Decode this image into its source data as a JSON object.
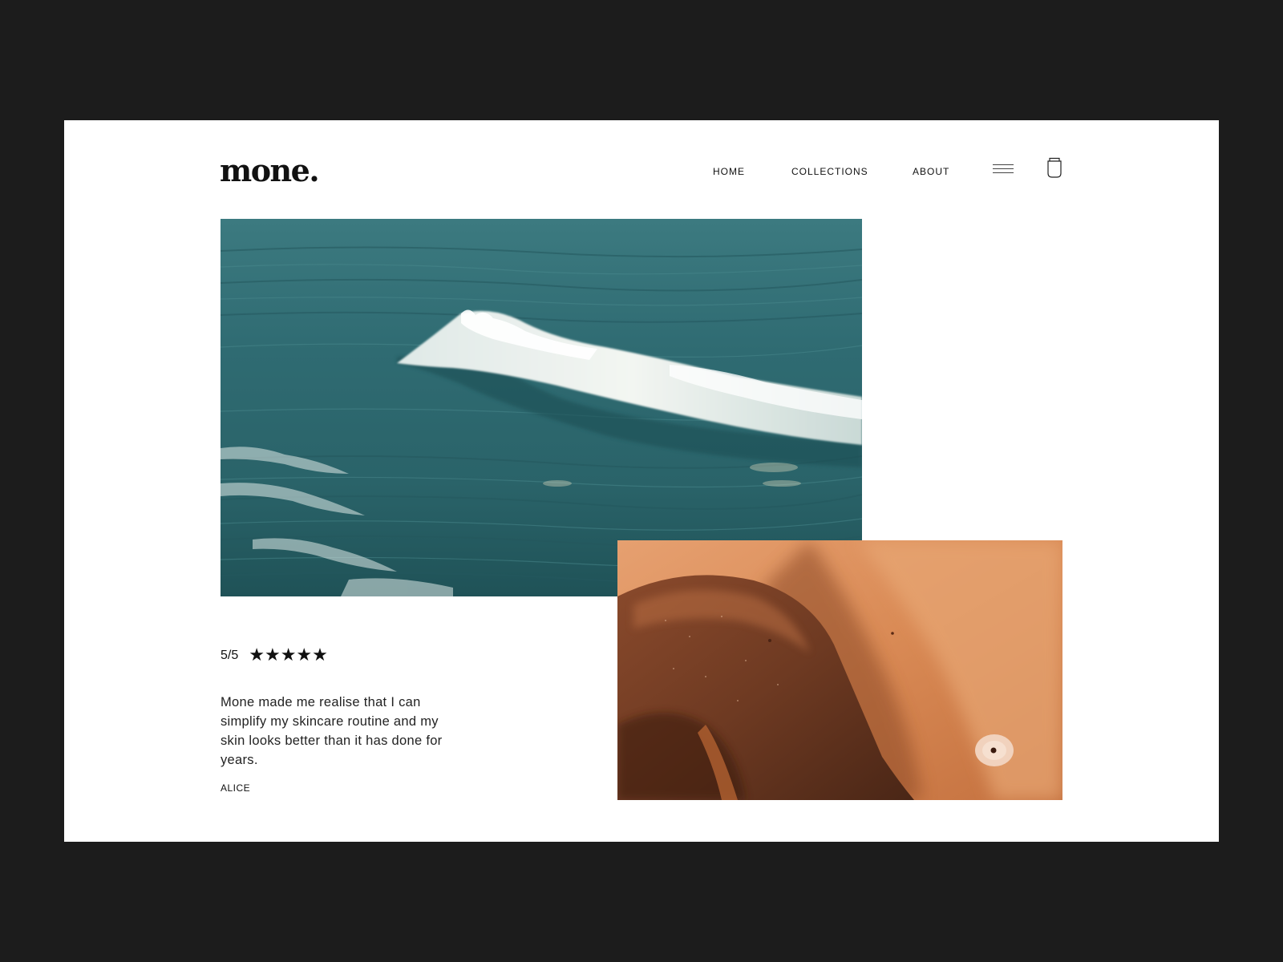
{
  "brand": {
    "logo": "mone."
  },
  "nav": {
    "items": [
      "HOME",
      "COLLECTIONS",
      "ABOUT"
    ]
  },
  "icons": {
    "menu": "menu-icon",
    "bag": "shopping-bag-icon"
  },
  "images": {
    "hero": "ocean-wave-photo",
    "secondary": "sunlit-skin-photo"
  },
  "review": {
    "score": "5/5",
    "rating_value": 5,
    "rating_max": 5,
    "stars": "★★★★★",
    "quote": "Mone made me realise that I can simplify my skincare routine and my skin looks better than it has done for years.",
    "author": "ALICE"
  },
  "colors": {
    "backdrop": "#1c1c1c",
    "page": "#ffffff",
    "text": "#111111",
    "ocean": "#2f6a70",
    "skin": "#c97a4a"
  }
}
